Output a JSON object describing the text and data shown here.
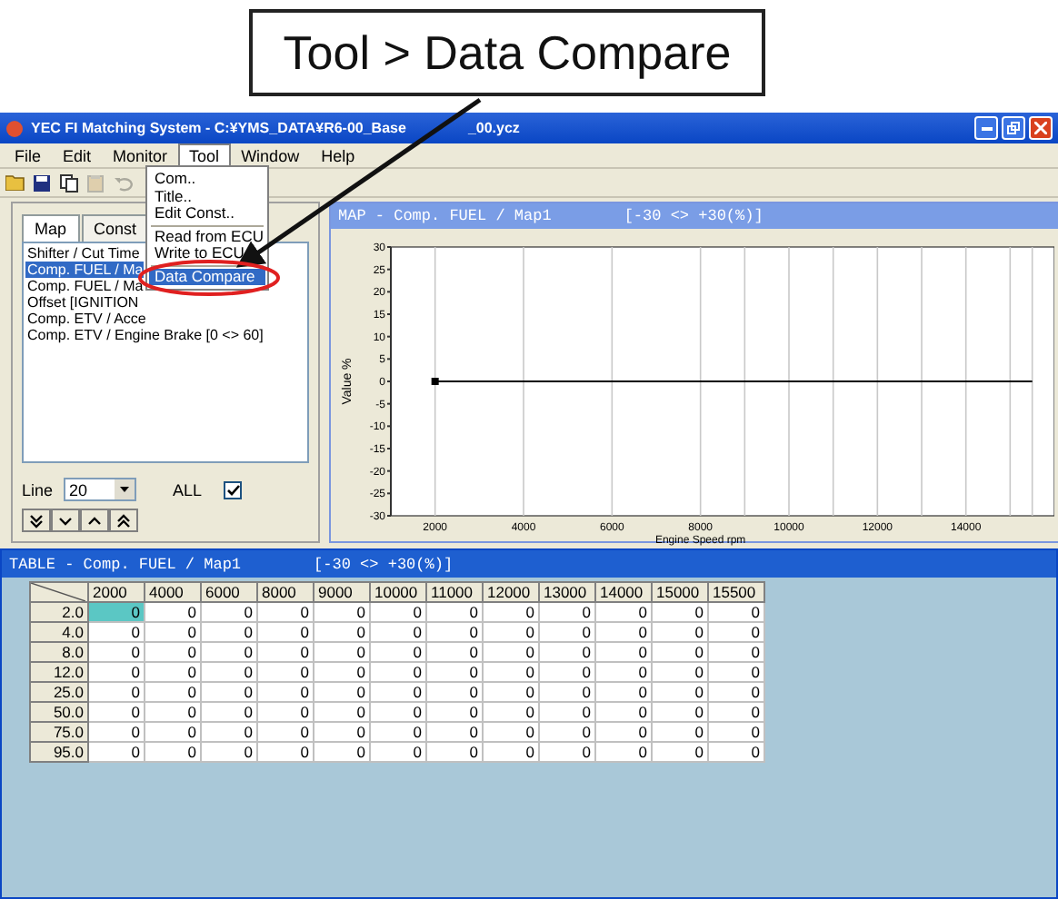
{
  "callout": {
    "text": "Tool > Data Compare"
  },
  "window": {
    "title_parts": [
      "YEC FI Matching System - C:¥YMS_DATA¥R6-00_Base",
      "_00.ycz"
    ]
  },
  "menu_bar": [
    {
      "label": "File",
      "selected": false
    },
    {
      "label": "Edit",
      "selected": false
    },
    {
      "label": "Monitor",
      "selected": false
    },
    {
      "label": "Tool",
      "selected": true
    },
    {
      "label": "Window",
      "selected": false
    },
    {
      "label": "Help",
      "selected": false
    }
  ],
  "tool_menu": [
    {
      "kind": "item",
      "label": "Com..",
      "selected": false
    },
    {
      "kind": "item",
      "label": "Title..",
      "selected": false
    },
    {
      "kind": "item",
      "label": "Edit Const..",
      "selected": false
    },
    {
      "kind": "separator"
    },
    {
      "kind": "item",
      "label": "Read from ECU",
      "selected": false
    },
    {
      "kind": "item",
      "label": "Write to ECU",
      "selected": false
    },
    {
      "kind": "separator"
    },
    {
      "kind": "item",
      "label": "Data Compare",
      "selected": true
    }
  ],
  "toolbar": [
    {
      "kind": "open",
      "disabled": false
    },
    {
      "kind": "save",
      "disabled": false
    },
    {
      "kind": "copy",
      "disabled": false
    },
    {
      "kind": "paste",
      "disabled": true
    },
    {
      "kind": "undo",
      "disabled": true
    }
  ],
  "left_panel": {
    "tabs": [
      {
        "label": "Map",
        "selected": true
      },
      {
        "label": "Const",
        "selected": false
      }
    ],
    "list": [
      {
        "label": "Shifter / Cut Time",
        "selected": false
      },
      {
        "label": "Comp. FUEL / Ma",
        "selected": true
      },
      {
        "label": "Comp. FUEL / Ma",
        "selected": false
      },
      {
        "label": "Offset [IGNITION",
        "selected": false
      },
      {
        "label": "Comp. ETV / Acce",
        "selected": false
      },
      {
        "label": "Comp. ETV / Engine Brake   [0 <> 60]",
        "selected": false
      }
    ],
    "line_label": "Line",
    "line_value": "20",
    "all_label": "ALL",
    "all_checked": true
  },
  "map_window": {
    "title": "MAP - Comp. FUEL / Map1",
    "range": "[-30 <> +30(%)]",
    "chart_data": {
      "type": "line",
      "xlabel": "Engine Speed rpm",
      "ylabel": "Value %",
      "x": [
        2000,
        4000,
        6000,
        8000,
        9000,
        10000,
        11000,
        12000,
        13000,
        14000,
        15000,
        15500
      ],
      "series": [
        {
          "color": "#000000",
          "values": [
            0,
            0,
            0,
            0,
            0,
            0,
            0,
            0,
            0,
            0,
            0,
            0
          ]
        }
      ],
      "grid": true,
      "xlim": [
        1000,
        16000
      ],
      "ylim": [
        -30,
        30
      ],
      "xticks": [
        2000,
        4000,
        6000,
        8000,
        10000,
        12000,
        14000
      ],
      "yticks": [
        -30,
        -25,
        -20,
        -15,
        -10,
        -5,
        0,
        5,
        10,
        15,
        20,
        25,
        30
      ]
    }
  },
  "table_window": {
    "title": "TABLE - Comp. FUEL / Map1",
    "range": "[-30 <> +30(%)]",
    "columns": [
      "2000",
      "4000",
      "6000",
      "8000",
      "9000",
      "10000",
      "11000",
      "12000",
      "13000",
      "14000",
      "15000",
      "15500"
    ],
    "rows": [
      {
        "label": "2.0",
        "cells": [
          {
            "value": "0",
            "selected": true
          },
          {
            "value": "0",
            "selected": false
          },
          {
            "value": "0",
            "selected": false
          },
          {
            "value": "0",
            "selected": false
          },
          {
            "value": "0",
            "selected": false
          },
          {
            "value": "0",
            "selected": false
          },
          {
            "value": "0",
            "selected": false
          },
          {
            "value": "0",
            "selected": false
          },
          {
            "value": "0",
            "selected": false
          },
          {
            "value": "0",
            "selected": false
          },
          {
            "value": "0",
            "selected": false
          },
          {
            "value": "0",
            "selected": false
          }
        ]
      },
      {
        "label": "4.0",
        "cells": [
          {
            "value": "0",
            "selected": false
          },
          {
            "value": "0",
            "selected": false
          },
          {
            "value": "0",
            "selected": false
          },
          {
            "value": "0",
            "selected": false
          },
          {
            "value": "0",
            "selected": false
          },
          {
            "value": "0",
            "selected": false
          },
          {
            "value": "0",
            "selected": false
          },
          {
            "value": "0",
            "selected": false
          },
          {
            "value": "0",
            "selected": false
          },
          {
            "value": "0",
            "selected": false
          },
          {
            "value": "0",
            "selected": false
          },
          {
            "value": "0",
            "selected": false
          }
        ]
      },
      {
        "label": "8.0",
        "cells": [
          {
            "value": "0",
            "selected": false
          },
          {
            "value": "0",
            "selected": false
          },
          {
            "value": "0",
            "selected": false
          },
          {
            "value": "0",
            "selected": false
          },
          {
            "value": "0",
            "selected": false
          },
          {
            "value": "0",
            "selected": false
          },
          {
            "value": "0",
            "selected": false
          },
          {
            "value": "0",
            "selected": false
          },
          {
            "value": "0",
            "selected": false
          },
          {
            "value": "0",
            "selected": false
          },
          {
            "value": "0",
            "selected": false
          },
          {
            "value": "0",
            "selected": false
          }
        ]
      },
      {
        "label": "12.0",
        "cells": [
          {
            "value": "0",
            "selected": false
          },
          {
            "value": "0",
            "selected": false
          },
          {
            "value": "0",
            "selected": false
          },
          {
            "value": "0",
            "selected": false
          },
          {
            "value": "0",
            "selected": false
          },
          {
            "value": "0",
            "selected": false
          },
          {
            "value": "0",
            "selected": false
          },
          {
            "value": "0",
            "selected": false
          },
          {
            "value": "0",
            "selected": false
          },
          {
            "value": "0",
            "selected": false
          },
          {
            "value": "0",
            "selected": false
          },
          {
            "value": "0",
            "selected": false
          }
        ]
      },
      {
        "label": "25.0",
        "cells": [
          {
            "value": "0",
            "selected": false
          },
          {
            "value": "0",
            "selected": false
          },
          {
            "value": "0",
            "selected": false
          },
          {
            "value": "0",
            "selected": false
          },
          {
            "value": "0",
            "selected": false
          },
          {
            "value": "0",
            "selected": false
          },
          {
            "value": "0",
            "selected": false
          },
          {
            "value": "0",
            "selected": false
          },
          {
            "value": "0",
            "selected": false
          },
          {
            "value": "0",
            "selected": false
          },
          {
            "value": "0",
            "selected": false
          },
          {
            "value": "0",
            "selected": false
          }
        ]
      },
      {
        "label": "50.0",
        "cells": [
          {
            "value": "0",
            "selected": false
          },
          {
            "value": "0",
            "selected": false
          },
          {
            "value": "0",
            "selected": false
          },
          {
            "value": "0",
            "selected": false
          },
          {
            "value": "0",
            "selected": false
          },
          {
            "value": "0",
            "selected": false
          },
          {
            "value": "0",
            "selected": false
          },
          {
            "value": "0",
            "selected": false
          },
          {
            "value": "0",
            "selected": false
          },
          {
            "value": "0",
            "selected": false
          },
          {
            "value": "0",
            "selected": false
          },
          {
            "value": "0",
            "selected": false
          }
        ]
      },
      {
        "label": "75.0",
        "cells": [
          {
            "value": "0",
            "selected": false
          },
          {
            "value": "0",
            "selected": false
          },
          {
            "value": "0",
            "selected": false
          },
          {
            "value": "0",
            "selected": false
          },
          {
            "value": "0",
            "selected": false
          },
          {
            "value": "0",
            "selected": false
          },
          {
            "value": "0",
            "selected": false
          },
          {
            "value": "0",
            "selected": false
          },
          {
            "value": "0",
            "selected": false
          },
          {
            "value": "0",
            "selected": false
          },
          {
            "value": "0",
            "selected": false
          },
          {
            "value": "0",
            "selected": false
          }
        ]
      },
      {
        "label": "95.0",
        "cells": [
          {
            "value": "0",
            "selected": false
          },
          {
            "value": "0",
            "selected": false
          },
          {
            "value": "0",
            "selected": false
          },
          {
            "value": "0",
            "selected": false
          },
          {
            "value": "0",
            "selected": false
          },
          {
            "value": "0",
            "selected": false
          },
          {
            "value": "0",
            "selected": false
          },
          {
            "value": "0",
            "selected": false
          },
          {
            "value": "0",
            "selected": false
          },
          {
            "value": "0",
            "selected": false
          },
          {
            "value": "0",
            "selected": false
          },
          {
            "value": "0",
            "selected": false
          }
        ]
      }
    ]
  }
}
